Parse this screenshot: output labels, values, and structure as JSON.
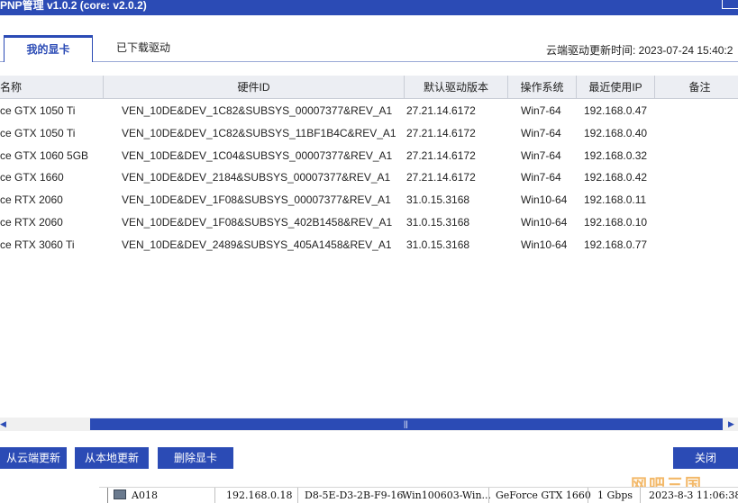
{
  "window": {
    "title": "PNP管理 v1.0.2 (core: v2.0.2)"
  },
  "tabs": [
    {
      "label": "我的显卡",
      "active": true
    },
    {
      "label": "已下载驱动",
      "active": false
    }
  ],
  "sync_time": "云端驱动更新时间: 2023-07-24 15:40:2",
  "table": {
    "columns": [
      "名称",
      "硬件ID",
      "默认驱动版本",
      "操作系统",
      "最近使用IP",
      "备注"
    ],
    "rows": [
      [
        "ce GTX 1050 Ti",
        "VEN_10DE&DEV_1C82&SUBSYS_00007377&REV_A1",
        "27.21.14.6172",
        "Win7-64",
        "192.168.0.47",
        ""
      ],
      [
        "ce GTX 1050 Ti",
        "VEN_10DE&DEV_1C82&SUBSYS_11BF1B4C&REV_A1",
        "27.21.14.6172",
        "Win7-64",
        "192.168.0.40",
        ""
      ],
      [
        "ce GTX 1060 5GB",
        "VEN_10DE&DEV_1C04&SUBSYS_00007377&REV_A1",
        "27.21.14.6172",
        "Win7-64",
        "192.168.0.32",
        ""
      ],
      [
        "ce GTX 1660",
        "VEN_10DE&DEV_2184&SUBSYS_00007377&REV_A1",
        "27.21.14.6172",
        "Win7-64",
        "192.168.0.42",
        ""
      ],
      [
        "ce RTX 2060",
        "VEN_10DE&DEV_1F08&SUBSYS_00007377&REV_A1",
        "31.0.15.3168",
        "Win10-64",
        "192.168.0.11",
        ""
      ],
      [
        "ce RTX 2060",
        "VEN_10DE&DEV_1F08&SUBSYS_402B1458&REV_A1",
        "31.0.15.3168",
        "Win10-64",
        "192.168.0.10",
        ""
      ],
      [
        "ce RTX 3060 Ti",
        "VEN_10DE&DEV_2489&SUBSYS_405A1458&REV_A1",
        "31.0.15.3168",
        "Win10-64",
        "192.168.0.77",
        ""
      ]
    ]
  },
  "buttons": {
    "cloud_update": "从云端更新",
    "local_update": "从本地更新",
    "delete_gpu": "删除显卡",
    "close": "关闭"
  },
  "watermark": "网吧三国",
  "background_row": {
    "name": "A018",
    "ip": "192.168.0.18",
    "mac": "D8-5E-D3-2B-F9-16",
    "os": "Win100603-Win...",
    "gpu": "GeForce GTX 1660",
    "speed": "1 Gbps",
    "time": "2023-8-3 11:06:38"
  },
  "colors": {
    "accent": "#2b4bb5",
    "header_bg": "#eceef3",
    "watermark": "#f2b25a"
  }
}
